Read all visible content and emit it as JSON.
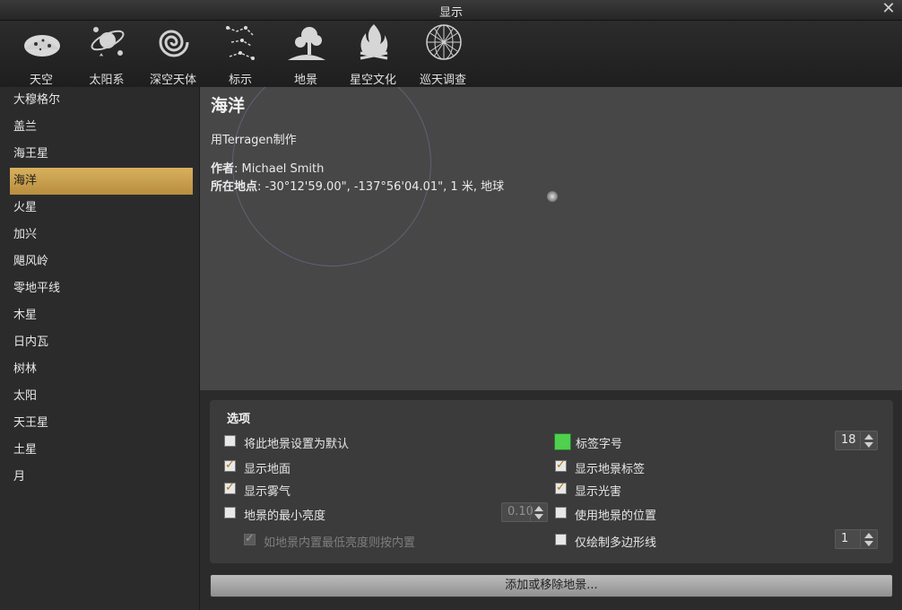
{
  "window": {
    "title": "显示",
    "close_glyph": "✕"
  },
  "toolbar": [
    {
      "label": "天空",
      "icon": "sky-icon"
    },
    {
      "label": "太阳系",
      "icon": "solar-system-icon"
    },
    {
      "label": "深空天体",
      "icon": "deep-sky-icon"
    },
    {
      "label": "标示",
      "icon": "markings-icon"
    },
    {
      "label": "地景",
      "icon": "landscape-icon"
    },
    {
      "label": "星空文化",
      "icon": "starlore-icon"
    },
    {
      "label": "巡天调查",
      "icon": "surveys-icon"
    }
  ],
  "landscapes": [
    "大穆格尔",
    "盖兰",
    "海王星",
    "海洋",
    "火星",
    "加兴",
    "飓风岭",
    "零地平线",
    "木星",
    "日内瓦",
    "树林",
    "太阳",
    "天王星",
    "土星",
    "月"
  ],
  "selected_index": 3,
  "detail": {
    "name": "海洋",
    "description": "用Terragen制作",
    "author_label": "作者",
    "author": ": Michael Smith",
    "location_label": "所在地点",
    "location": ": -30°12'59.00\", -137°56'04.01\", 1 米, 地球"
  },
  "options": {
    "title": "选项",
    "set_default": {
      "label": "将此地景设置为默认",
      "checked": false
    },
    "show_ground": {
      "label": "显示地面",
      "checked": true
    },
    "show_fog": {
      "label": "显示雾气",
      "checked": true
    },
    "min_brightness": {
      "label": "地景的最小亮度",
      "checked": false,
      "value": "0.10"
    },
    "override_brightness": {
      "label": "如地景内置最低亮度则按内置",
      "checked": true
    },
    "label_font_size": {
      "label": "标签字号",
      "value": "18",
      "swatch_color": "#4fd04f"
    },
    "show_labels": {
      "label": "显示地景标签",
      "checked": true
    },
    "light_pollution": {
      "label": "显示光害",
      "checked": true
    },
    "use_location": {
      "label": "使用地景的位置",
      "checked": false
    },
    "polygon_only": {
      "label": "仅绘制多边形线",
      "checked": false,
      "value": "1"
    }
  },
  "add_remove_button": "添加或移除地景..."
}
